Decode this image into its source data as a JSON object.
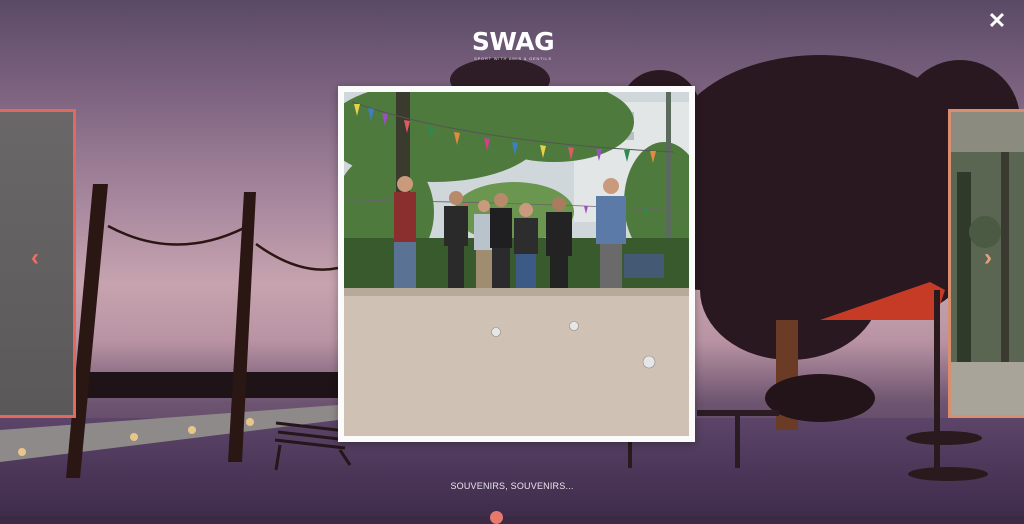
{
  "brand": {
    "name": "SWAG",
    "tagline": "SPORT WITH AMIS & GENTILS"
  },
  "controls": {
    "close_icon": "close-icon",
    "close_glyph": "✕",
    "prev_icon": "chevron-left-icon",
    "prev_glyph": "‹",
    "next_icon": "chevron-right-icon",
    "next_glyph": "›"
  },
  "gallery": {
    "caption": "SOUVENIRS, SOUVENIRS...",
    "active_image": "petanque players in a park under colourful bunting",
    "pager": {
      "count": 1,
      "active": 1
    }
  },
  "colors": {
    "accent": "#e06a5f",
    "accent_right": "#d98f6d",
    "frame": "#fbfbfb"
  }
}
